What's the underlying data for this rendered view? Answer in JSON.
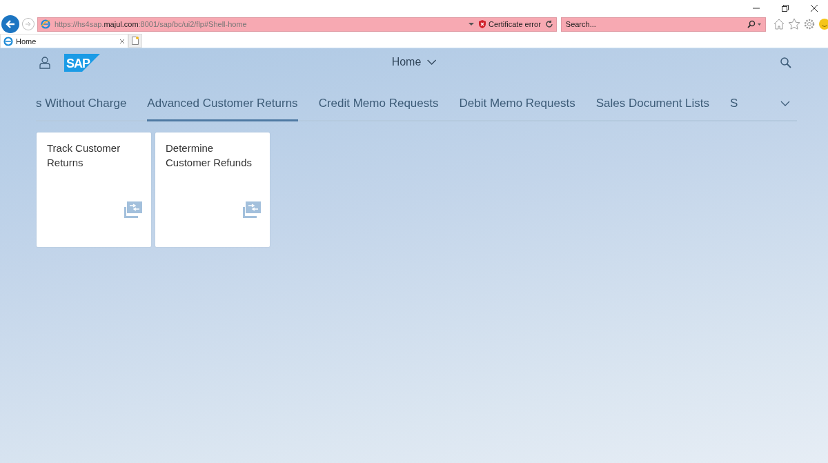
{
  "browser": {
    "address": "https://hs4sap.**majul.com**:8001/sap/bc/ui2/flp#Shell-home",
    "certificate_status": "Certificate error",
    "search": {
      "placeholder": "Search..."
    },
    "tabs": [
      {
        "label": "Home",
        "selected": true
      }
    ]
  },
  "shell": {
    "logo": "SAP",
    "title": "Home"
  },
  "groups": [
    {
      "label": "s Without Charge",
      "selected": false
    },
    {
      "label": "Advanced Customer Returns",
      "selected": true
    },
    {
      "label": "Credit Memo Requests",
      "selected": false
    },
    {
      "label": "Debit Memo Requests",
      "selected": false
    },
    {
      "label": "Sales Document Lists",
      "selected": false
    },
    {
      "label": "S",
      "selected": false
    }
  ],
  "tiles": [
    {
      "title": "Track Customer Returns"
    },
    {
      "title": "Determine Customer Refunds"
    }
  ]
}
